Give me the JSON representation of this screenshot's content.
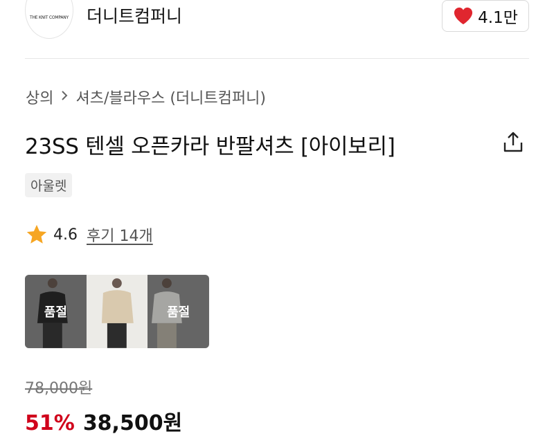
{
  "brand": {
    "logo_text": "THE KNIT COMPANY",
    "name": "더니트컴퍼니"
  },
  "like": {
    "count": "4.1만",
    "icon": "heart-icon",
    "color": "#e0262f"
  },
  "breadcrumb": {
    "items": [
      "상의",
      "셔츠/블라우스 (더니트컴퍼니)"
    ],
    "separator_icon": "chevron-right-icon"
  },
  "product": {
    "title": "23SS 텐셀 오픈카라 반팔셔츠 [아이보리]",
    "tag": "아울렛",
    "share_icon": "share-icon"
  },
  "rating": {
    "value": "4.6",
    "review_link": "후기 14개",
    "star_color": "#f6a623"
  },
  "options": [
    {
      "label": "품절",
      "sold_out": true
    },
    {
      "label": "",
      "sold_out": false
    },
    {
      "label": "품절",
      "sold_out": true
    }
  ],
  "price": {
    "original": "78,000원",
    "discount": "51%",
    "sale": "38,500원",
    "discount_color": "#d0021b"
  }
}
